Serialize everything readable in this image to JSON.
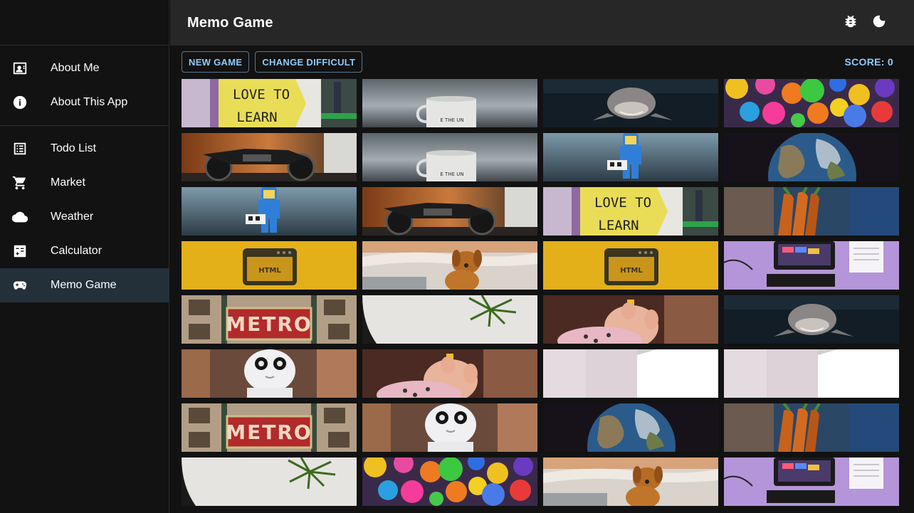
{
  "appbar": {
    "title": "Memo Game",
    "bug_icon": "bug-icon",
    "theme_icon": "moon-icon"
  },
  "sidebar": {
    "groups": [
      {
        "items": [
          {
            "label": "About Me",
            "icon": "contact-card-icon"
          },
          {
            "label": "About This App",
            "icon": "info-icon"
          }
        ]
      },
      {
        "items": [
          {
            "label": "Todo List",
            "icon": "list-icon"
          },
          {
            "label": "Market",
            "icon": "cart-icon"
          },
          {
            "label": "Weather",
            "icon": "cloud-icon"
          },
          {
            "label": "Calculator",
            "icon": "calculator-icon"
          },
          {
            "label": "Memo Game",
            "icon": "gamepad-icon",
            "active": true
          }
        ]
      }
    ]
  },
  "toolbar": {
    "new_game_label": "NEW GAME",
    "change_difficulty_label": "CHANGE DIFFICULT",
    "score_label": "SCORE:",
    "score_value": "0"
  },
  "cards": [
    [
      "love-to-learn",
      "mug",
      "shark",
      "balls"
    ],
    [
      "motorcycle",
      "mug",
      "lego",
      "earth"
    ],
    [
      "lego",
      "motorcycle",
      "love-to-learn",
      "carrots"
    ],
    [
      "html",
      "dog",
      "html",
      "desk"
    ],
    [
      "metro",
      "plant",
      "baby",
      "shark"
    ],
    [
      "robot",
      "baby",
      "white",
      "white"
    ],
    [
      "metro",
      "robot",
      "earth",
      "carrots"
    ],
    [
      "plant",
      "balls",
      "dog",
      "desk"
    ]
  ],
  "image_text": {
    "love": "LOVE TO",
    "learn": "LEARN",
    "metro": "METRO",
    "html": "HTML"
  },
  "colors": {
    "accent": "#90caf9",
    "active_bg": "#233039",
    "appbar_bg": "#272727",
    "page_bg": "#121212"
  }
}
